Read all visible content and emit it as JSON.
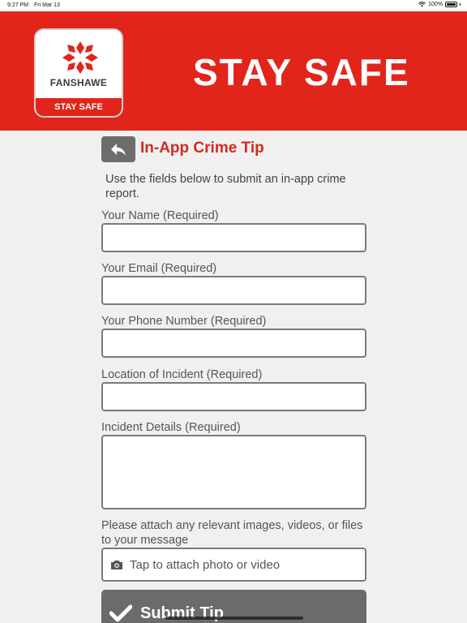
{
  "status_bar": {
    "time": "9:27 PM",
    "date": "Fri Mar 13",
    "battery": "100%"
  },
  "header": {
    "logo_name": "FANSHAWE",
    "logo_band": "STAY SAFE",
    "title": "STAY SAFE",
    "brand_color": "#e1251b"
  },
  "page": {
    "title": "In-App Crime Tip",
    "intro": "Use the fields below to submit an in-app crime report."
  },
  "form": {
    "name_label": "Your Name (Required)",
    "name_value": "",
    "email_label": "Your Email (Required)",
    "email_value": "",
    "phone_label": "Your Phone Number (Required)",
    "phone_value": "",
    "location_label": "Location of Incident (Required)",
    "location_value": "",
    "details_label": "Incident Details (Required)",
    "details_value": "",
    "attach_label": "Please attach any relevant images, videos, or files to your message",
    "attach_button": "Tap to attach photo or video",
    "submit_button": "Submit Tip"
  }
}
